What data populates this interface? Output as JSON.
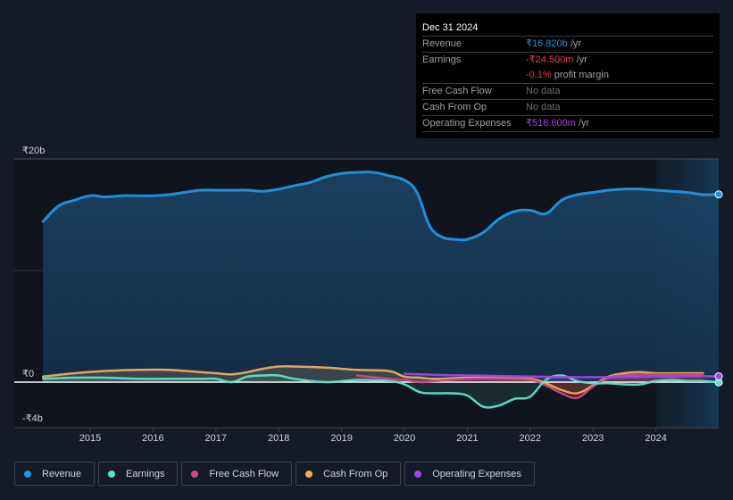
{
  "tooltip": {
    "date": "Dec 31 2024",
    "rows": [
      {
        "label": "Revenue",
        "value": "₹16.820b",
        "suffix": " /yr",
        "color": "#2394df"
      },
      {
        "label": "Earnings",
        "value": "-₹24.500m",
        "suffix": " /yr",
        "color": "#e64141"
      },
      {
        "label": "",
        "value": "-0.1%",
        "suffix": " profit margin",
        "color": "#e64141"
      },
      {
        "label": "Free Cash Flow",
        "value": "No data",
        "suffix": "",
        "color": "#6b7079"
      },
      {
        "label": "Cash From Op",
        "value": "No data",
        "suffix": "",
        "color": "#6b7079"
      },
      {
        "label": "Operating Expenses",
        "value": "₹518.600m",
        "suffix": " /yr",
        "color": "#a046e6"
      }
    ]
  },
  "legend": [
    {
      "label": "Revenue",
      "color": "#2394df"
    },
    {
      "label": "Earnings",
      "color": "#5fe0c8"
    },
    {
      "label": "Free Cash Flow",
      "color": "#c94a85"
    },
    {
      "label": "Cash From Op",
      "color": "#e9ae5e"
    },
    {
      "label": "Operating Expenses",
      "color": "#a046e6"
    }
  ],
  "chart_data": {
    "type": "area",
    "title": "",
    "xlabel": "",
    "ylabel": "",
    "y_tick_labels": [
      "₹20b",
      "₹0",
      "-₹4b"
    ],
    "y_ticks": [
      20,
      0,
      -4
    ],
    "ylim": [
      -4,
      20
    ],
    "xlim": [
      2014.0,
      2025.0
    ],
    "x_tick_labels": [
      "2015",
      "2016",
      "2017",
      "2018",
      "2019",
      "2020",
      "2021",
      "2022",
      "2023",
      "2024"
    ],
    "x_ticks": [
      2015,
      2016,
      2017,
      2018,
      2019,
      2020,
      2021,
      2022,
      2023,
      2024
    ],
    "forecast_shade_start": 2024.0,
    "units": "₹ billions",
    "series": [
      {
        "name": "Revenue",
        "color": "#2394df",
        "x": [
          2014.25,
          2014.5,
          2014.75,
          2015.0,
          2015.25,
          2015.5,
          2015.75,
          2016.0,
          2016.25,
          2016.5,
          2016.75,
          2017.0,
          2017.25,
          2017.5,
          2017.75,
          2018.0,
          2018.25,
          2018.5,
          2018.75,
          2019.0,
          2019.25,
          2019.5,
          2019.75,
          2020.0,
          2020.2,
          2020.4,
          2020.6,
          2020.8,
          2021.0,
          2021.25,
          2021.5,
          2021.75,
          2022.0,
          2022.25,
          2022.5,
          2022.75,
          2023.0,
          2023.25,
          2023.5,
          2023.75,
          2024.0,
          2024.25,
          2024.5,
          2024.75,
          2025.0
        ],
        "values": [
          14.4,
          15.8,
          16.3,
          16.7,
          16.6,
          16.7,
          16.7,
          16.7,
          16.8,
          17.0,
          17.2,
          17.2,
          17.2,
          17.2,
          17.1,
          17.3,
          17.6,
          17.9,
          18.4,
          18.7,
          18.8,
          18.8,
          18.5,
          18.1,
          17.0,
          14.0,
          13.0,
          12.8,
          12.8,
          13.4,
          14.6,
          15.3,
          15.4,
          15.1,
          16.3,
          16.8,
          17.0,
          17.2,
          17.3,
          17.3,
          17.2,
          17.1,
          17.0,
          16.8,
          16.82
        ]
      },
      {
        "name": "Earnings",
        "color": "#5fe0c8",
        "x": [
          2014.25,
          2014.75,
          2015.25,
          2015.75,
          2016.25,
          2016.75,
          2017.0,
          2017.25,
          2017.5,
          2017.75,
          2018.0,
          2018.25,
          2018.75,
          2019.25,
          2019.75,
          2020.0,
          2020.25,
          2020.5,
          2020.75,
          2021.0,
          2021.25,
          2021.5,
          2021.75,
          2022.0,
          2022.25,
          2022.5,
          2022.75,
          2023.0,
          2023.25,
          2023.5,
          2023.75,
          2024.0,
          2024.25,
          2024.5,
          2024.75,
          2025.0
        ],
        "values": [
          0.3,
          0.4,
          0.4,
          0.3,
          0.3,
          0.3,
          0.3,
          0.0,
          0.5,
          0.6,
          0.6,
          0.3,
          0.0,
          0.2,
          0.1,
          -0.2,
          -0.9,
          -1.0,
          -1.0,
          -1.2,
          -2.2,
          -2.1,
          -1.5,
          -1.3,
          0.2,
          0.6,
          0.1,
          -0.1,
          -0.1,
          -0.2,
          -0.2,
          0.1,
          0.2,
          0.1,
          0.1,
          -0.02
        ]
      },
      {
        "name": "Free Cash Flow",
        "color": "#c94a85",
        "x": [
          2019.25,
          2019.75,
          2020.0,
          2020.25,
          2020.5,
          2021.0,
          2021.5,
          2022.0,
          2022.25,
          2022.5,
          2022.75,
          2023.0,
          2023.25,
          2023.5,
          2024.0,
          2024.5,
          2024.75
        ],
        "values": [
          0.6,
          0.3,
          0.2,
          0.0,
          0.1,
          0.3,
          0.3,
          0.2,
          -0.3,
          -1.0,
          -1.4,
          -0.4,
          0.4,
          0.6,
          0.7,
          0.7,
          0.7
        ]
      },
      {
        "name": "Cash From Op",
        "color": "#e9ae5e",
        "x": [
          2014.25,
          2014.75,
          2015.25,
          2015.75,
          2016.25,
          2016.75,
          2017.0,
          2017.25,
          2017.5,
          2017.75,
          2018.0,
          2018.25,
          2018.75,
          2019.25,
          2019.75,
          2020.0,
          2020.25,
          2020.5,
          2021.0,
          2021.5,
          2022.0,
          2022.25,
          2022.5,
          2022.75,
          2023.0,
          2023.25,
          2023.5,
          2023.75,
          2024.0,
          2024.5,
          2024.75
        ],
        "values": [
          0.5,
          0.8,
          1.0,
          1.1,
          1.1,
          0.9,
          0.8,
          0.7,
          0.9,
          1.2,
          1.4,
          1.4,
          1.3,
          1.1,
          1.0,
          0.5,
          0.4,
          0.3,
          0.4,
          0.4,
          0.3,
          -0.1,
          -0.7,
          -1.0,
          -0.3,
          0.5,
          0.8,
          0.9,
          0.8,
          0.8,
          0.8
        ]
      },
      {
        "name": "Operating Expenses",
        "color": "#a046e6",
        "x": [
          2020.0,
          2020.5,
          2021.0,
          2021.5,
          2022.0,
          2022.5,
          2023.0,
          2023.5,
          2024.0,
          2024.5,
          2025.0
        ],
        "values": [
          0.75,
          0.65,
          0.6,
          0.55,
          0.5,
          0.45,
          0.45,
          0.45,
          0.5,
          0.52,
          0.52
        ]
      }
    ]
  }
}
